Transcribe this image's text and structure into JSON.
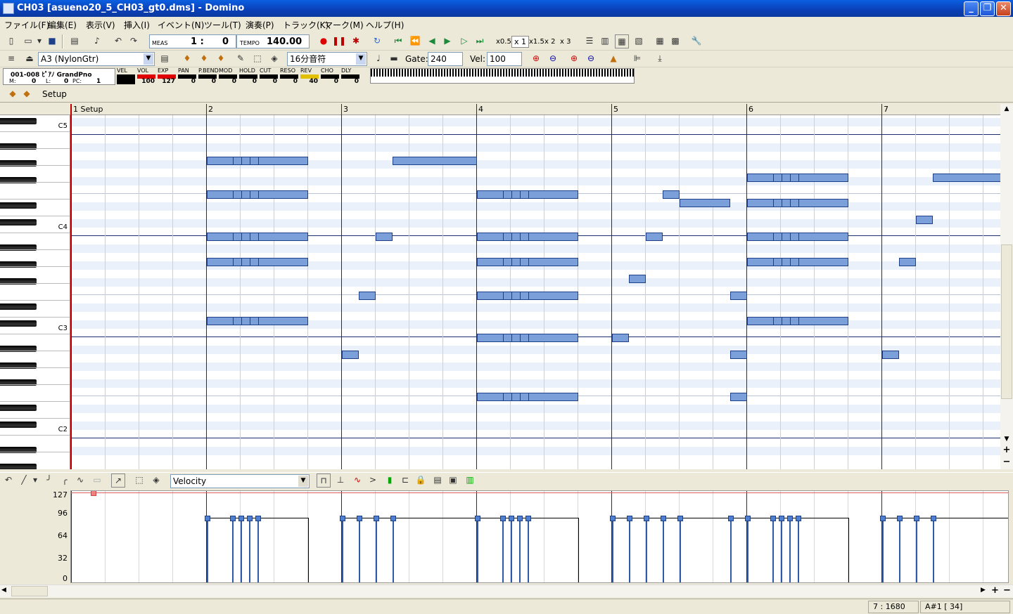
{
  "window": {
    "title": "CH03 [asueno20_5_CH03_gt0.dms] - Domino"
  },
  "menu": [
    "ファイル(F)",
    "編集(E)",
    "表示(V)",
    "挿入(I)",
    "イベント(N)",
    "ツール(T)",
    "演奏(P)",
    "トラック(K)",
    "マーク(M)",
    "ヘルプ(H)"
  ],
  "toolbar": {
    "meas_label": "MEAS",
    "meas_value": "1 :",
    "meas_tick": "0",
    "tempo_label": "TEMPO",
    "tempo_value": "140.00",
    "zoom_x05": "x0.5",
    "zoom_x1": "x 1",
    "zoom_x15": "x1.5",
    "zoom_x2": "x 2",
    "zoom_x3": "x 3"
  },
  "toolbar2": {
    "instrument": "A3  (NylonGtr)",
    "note_length": "16分音符",
    "gate_label": "Gate:",
    "gate_value": "240",
    "vel_label": "Vel:",
    "vel_value": "100"
  },
  "track": {
    "name": "001-008 ﾋﾟｱﾉ GrandPno",
    "m_label": "M:",
    "m_value": "0",
    "l_label": "L:",
    "l_value": "0",
    "pc_label": "PC:",
    "pc_value": "1",
    "setup_label": "Setup"
  },
  "params": [
    {
      "name": "VEL",
      "value": ""
    },
    {
      "name": "VOL",
      "value": "100",
      "color": "#e00000"
    },
    {
      "name": "EXP",
      "value": "127",
      "color": "#e00000"
    },
    {
      "name": "PAN",
      "value": "0"
    },
    {
      "name": "P.BEND",
      "value": "0"
    },
    {
      "name": "MOD",
      "value": "0"
    },
    {
      "name": "HOLD",
      "value": "0"
    },
    {
      "name": "CUT",
      "value": "0"
    },
    {
      "name": "RESO",
      "value": "0"
    },
    {
      "name": "REV",
      "value": "40",
      "color": "#e0c000"
    },
    {
      "name": "CHO",
      "value": "0"
    },
    {
      "name": "DLY",
      "value": "0"
    }
  ],
  "ruler": {
    "measures": [
      "1 Setup",
      "2",
      "3",
      "4",
      "5",
      "6",
      "7"
    ]
  },
  "keyboard": {
    "labels": [
      "C5",
      "C4",
      "C3",
      "C2"
    ]
  },
  "event_pane": {
    "type": "Velocity",
    "y_labels": [
      "127",
      "96",
      "64",
      "32",
      "0"
    ]
  },
  "status": {
    "position": "7 : 1680",
    "note": "A#1 [ 34]"
  },
  "colors": {
    "note_fill": "#7b9fd8",
    "note_border": "#1e3f8a",
    "bar_line": "#1b2d6b",
    "beat_line": "#c5d2e6",
    "black_row": "#eaf1fa"
  }
}
